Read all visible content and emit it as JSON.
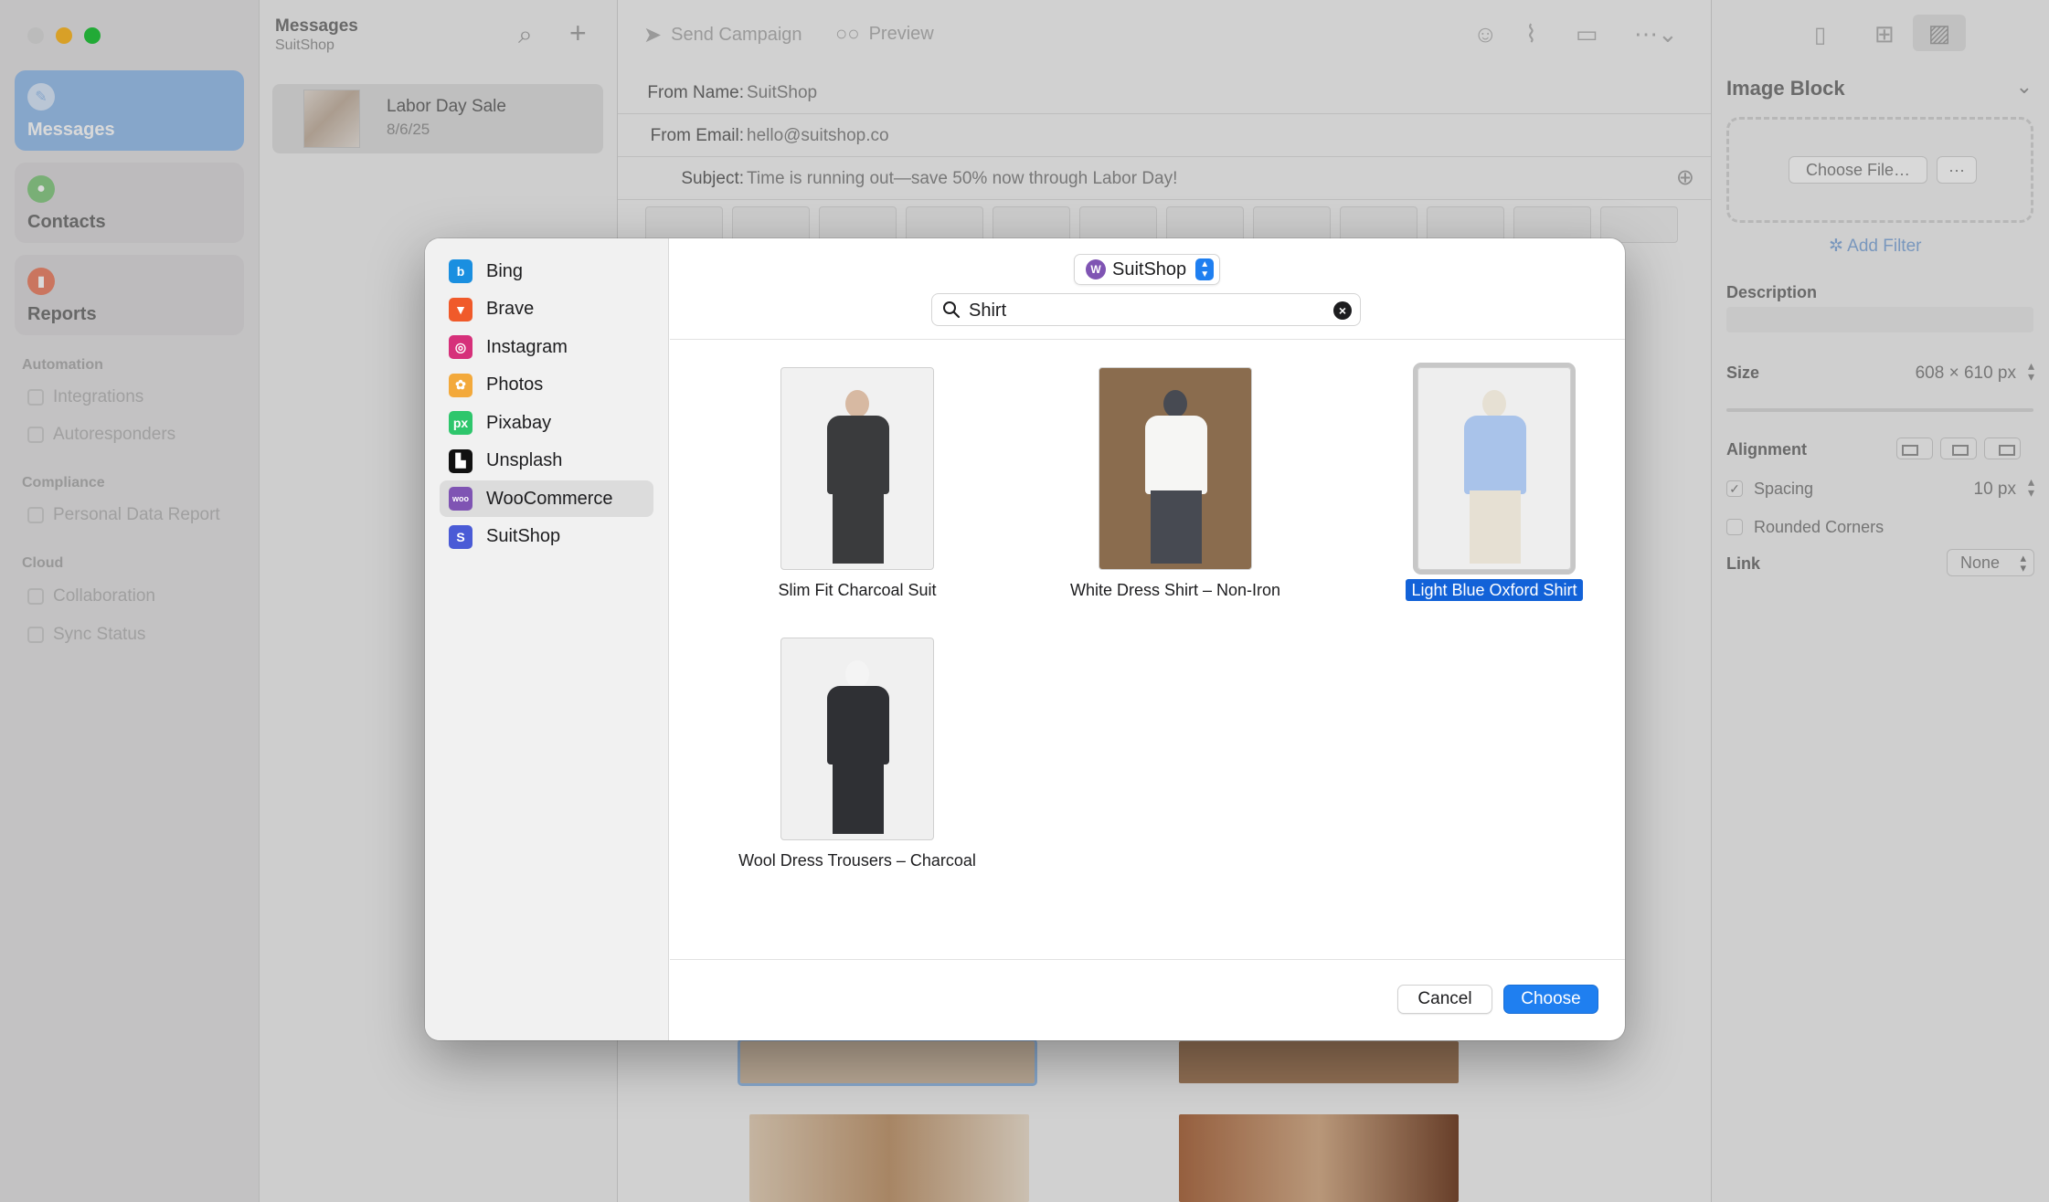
{
  "window": {
    "traffic_colors": [
      "#dcdcdc",
      "#febc2e",
      "#28c840"
    ]
  },
  "sidebar": {
    "nav": [
      {
        "label": "Messages",
        "icon": "compose-icon",
        "color": "#9ec3ee"
      },
      {
        "label": "Contacts",
        "icon": "person-icon",
        "color": "#6fc36a"
      },
      {
        "label": "Reports",
        "icon": "chart-icon",
        "color": "#ee6f4f"
      }
    ],
    "sections": [
      {
        "title": "Automation",
        "items": [
          "Integrations",
          "Autoresponders"
        ]
      },
      {
        "title": "Compliance",
        "items": [
          "Personal Data Report"
        ]
      },
      {
        "title": "Cloud",
        "items": [
          "Collaboration",
          "Sync Status"
        ]
      }
    ]
  },
  "message_list": {
    "title": "Messages",
    "subtitle": "SuitShop",
    "items": [
      {
        "title": "Labor Day Sale",
        "date": "8/6/25"
      }
    ]
  },
  "composer": {
    "toolbar": {
      "send": "Send Campaign",
      "preview": "Preview"
    },
    "from_name_label": "From Name:",
    "from_name": "SuitShop",
    "from_email_label": "From Email:",
    "from_email": "hello@suitshop.co",
    "subject_label": "Subject:",
    "subject": "Time is running out—save 50% now through Labor Day!"
  },
  "inspector": {
    "title": "Image Block",
    "choose_file": "Choose File…",
    "more": "···",
    "add_filter": "Add Filter",
    "description_label": "Description",
    "size_label": "Size",
    "size_value": "608 × 610 px",
    "alignment_label": "Alignment",
    "spacing_label": "Spacing",
    "spacing_checked": true,
    "spacing_value": "10 px",
    "rounded_label": "Rounded Corners",
    "rounded_checked": false,
    "link_label": "Link",
    "link_value": "None"
  },
  "picker": {
    "sources": [
      {
        "label": "Bing",
        "icon": "bing-icon",
        "color": "#1a8fe0",
        "glyph": "b"
      },
      {
        "label": "Brave",
        "icon": "brave-icon",
        "color": "#f05a2a",
        "glyph": "▼"
      },
      {
        "label": "Instagram",
        "icon": "instagram-icon",
        "color": "#d6307a",
        "glyph": "◎"
      },
      {
        "label": "Photos",
        "icon": "photos-icon",
        "color": "#f3a93b",
        "glyph": "✿"
      },
      {
        "label": "Pixabay",
        "icon": "pixabay-icon",
        "color": "#2ec66c",
        "glyph": "px"
      },
      {
        "label": "Unsplash",
        "icon": "unsplash-icon",
        "color": "#111111",
        "glyph": "▙"
      },
      {
        "label": "WooCommerce",
        "icon": "woocommerce-icon",
        "color": "#7f54b3",
        "glyph": "woo"
      },
      {
        "label": "SuitShop",
        "icon": "suitshop-icon",
        "color": "#4a5bd6",
        "glyph": "S"
      }
    ],
    "selected_source": "WooCommerce",
    "store": {
      "label": "SuitShop",
      "logo": "W"
    },
    "search": {
      "value": "Shirt",
      "placeholder": "Search"
    },
    "results": [
      {
        "caption": "Slim Fit Charcoal Suit",
        "selected": false,
        "palette": [
          "#f1f1f1",
          "#3a3b3d",
          "#d7b9a2"
        ]
      },
      {
        "caption": "White Dress Shirt – Non-Iron",
        "selected": false,
        "palette": [
          "#8a6c4e",
          "#f6f6f4",
          "#474a52"
        ]
      },
      {
        "caption": "Light Blue Oxford Shirt",
        "selected": true,
        "palette": [
          "#eeeeee",
          "#a9c3ea",
          "#e6e0d3"
        ]
      },
      {
        "caption": "Wool Dress Trousers – Charcoal",
        "selected": false,
        "palette": [
          "#f0f0f0",
          "#2f3034",
          "#f4f4f4"
        ]
      }
    ],
    "cancel": "Cancel",
    "choose": "Choose"
  }
}
